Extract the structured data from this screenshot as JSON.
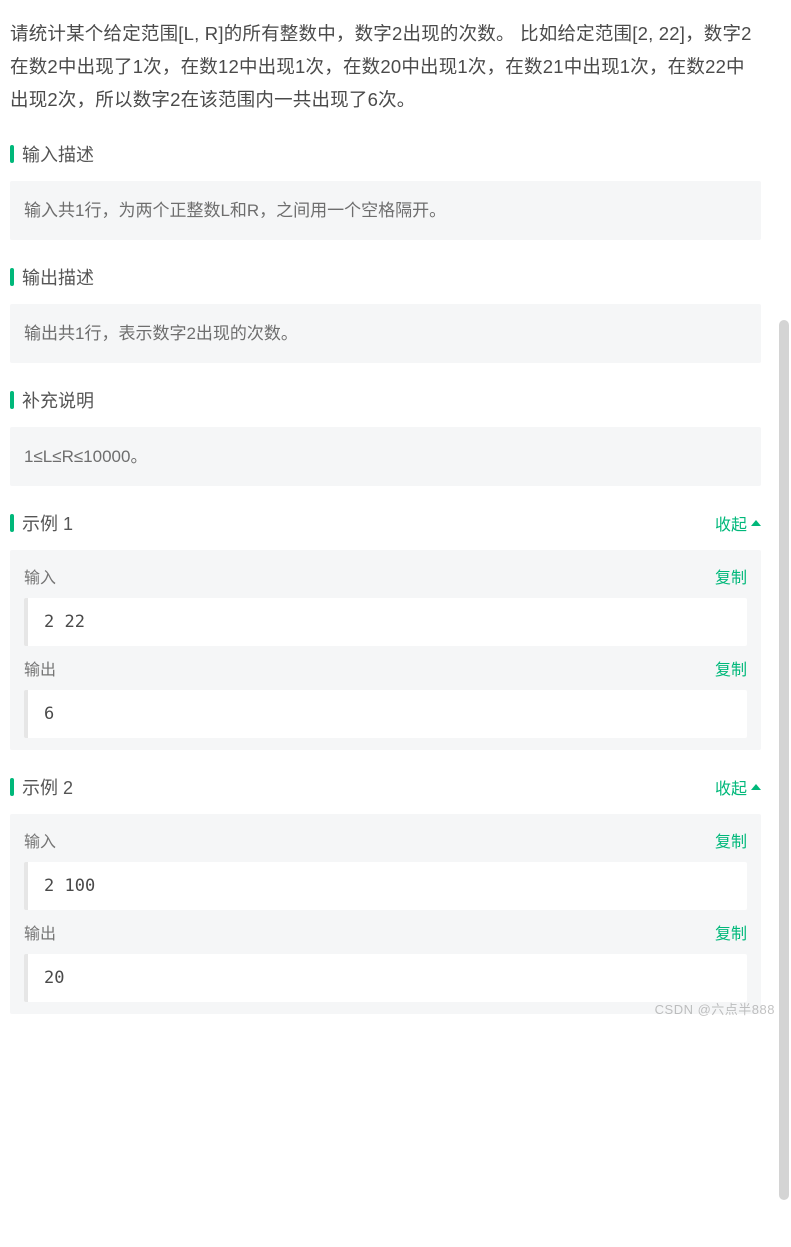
{
  "problem": {
    "description": "请统计某个给定范围[L, R]的所有整数中，数字2出现的次数。\n比如给定范围[2, 22]，数字2在数2中出现了1次，在数12中出现1次，在数20中出现1次，在数21中出现1次，在数22中出现2次，所以数字2在该范围内一共出现了6次。"
  },
  "sections": {
    "input_desc": {
      "title": "输入描述",
      "content": "输入共1行，为两个正整数L和R，之间用一个空格隔开。"
    },
    "output_desc": {
      "title": "输出描述",
      "content": "输出共1行，表示数字2出现的次数。"
    },
    "supplement": {
      "title": "补充说明",
      "content": "1≤L≤R≤10000。"
    }
  },
  "labels": {
    "collapse": "收起",
    "copy": "复制",
    "input": "输入",
    "output": "输出"
  },
  "examples": [
    {
      "title": "示例 1",
      "input": "2 22",
      "output": "6"
    },
    {
      "title": "示例 2",
      "input": "2 100",
      "output": "20"
    }
  ],
  "watermark": "CSDN @六点半888"
}
